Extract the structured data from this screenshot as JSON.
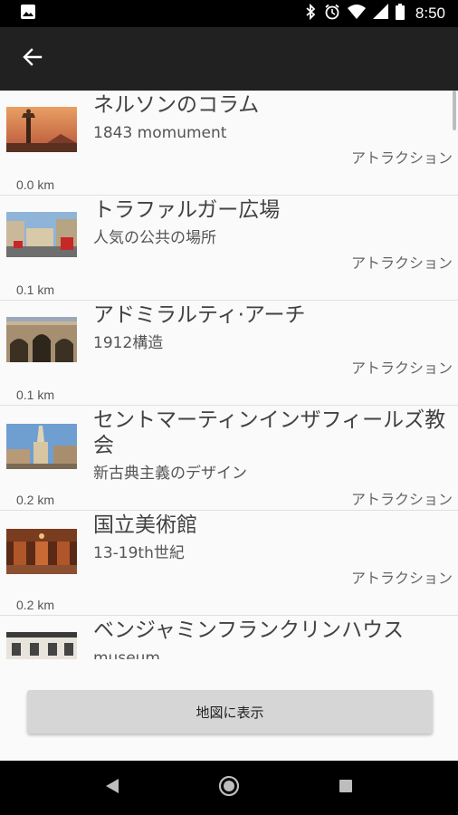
{
  "status_bar": {
    "time": "8:50",
    "icons": [
      "image-icon",
      "bluetooth-icon",
      "alarm-icon",
      "wifi-icon",
      "signal-icon",
      "battery-icon"
    ]
  },
  "app_bar": {
    "back_icon": "arrow-left-icon"
  },
  "places": [
    {
      "name": "ネルソンのコラム",
      "description": "1843 momument",
      "category": "アトラクション",
      "distance": "0.0 km"
    },
    {
      "name": "トラファルガー広場",
      "description": "人気の公共の場所",
      "category": "アトラクション",
      "distance": "0.1 km"
    },
    {
      "name": "アドミラルティ·アーチ",
      "description": "1912構造",
      "category": "アトラクション",
      "distance": "0.1 km"
    },
    {
      "name": "セントマーティンインザフィールズ教会",
      "description": "新古典主義のデザイン",
      "category": "アトラクション",
      "distance": "0.2 km"
    },
    {
      "name": "国立美術館",
      "description": "13-19th世紀",
      "category": "アトラクション",
      "distance": "0.2 km"
    },
    {
      "name": "ベンジャミンフランクリンハウス",
      "description": "museum",
      "category": "",
      "distance": ""
    }
  ],
  "map_button_label": "地図に表示",
  "nav_bar": {
    "back": "back-icon",
    "home": "home-icon",
    "recents": "recents-icon"
  }
}
